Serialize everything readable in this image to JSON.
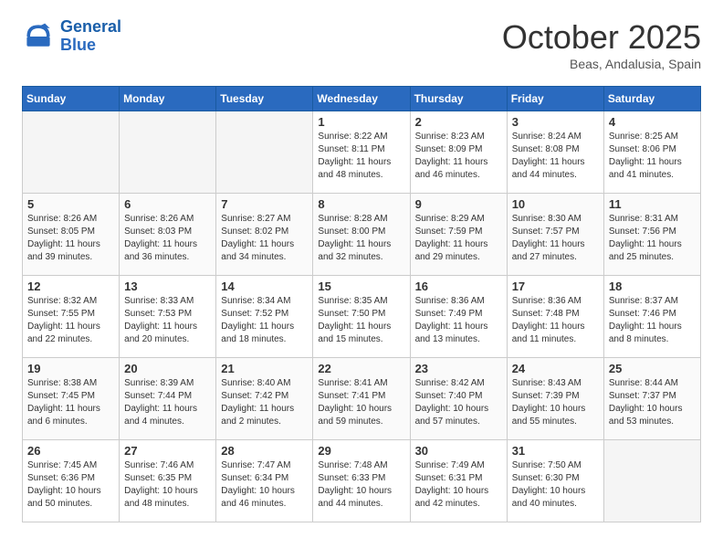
{
  "header": {
    "logo_line1": "General",
    "logo_line2": "Blue",
    "month": "October 2025",
    "location": "Beas, Andalusia, Spain"
  },
  "days_of_week": [
    "Sunday",
    "Monday",
    "Tuesday",
    "Wednesday",
    "Thursday",
    "Friday",
    "Saturday"
  ],
  "weeks": [
    [
      {
        "day": "",
        "empty": true
      },
      {
        "day": "",
        "empty": true
      },
      {
        "day": "",
        "empty": true
      },
      {
        "day": "1",
        "sunrise": "Sunrise: 8:22 AM",
        "sunset": "Sunset: 8:11 PM",
        "daylight": "Daylight: 11 hours and 48 minutes."
      },
      {
        "day": "2",
        "sunrise": "Sunrise: 8:23 AM",
        "sunset": "Sunset: 8:09 PM",
        "daylight": "Daylight: 11 hours and 46 minutes."
      },
      {
        "day": "3",
        "sunrise": "Sunrise: 8:24 AM",
        "sunset": "Sunset: 8:08 PM",
        "daylight": "Daylight: 11 hours and 44 minutes."
      },
      {
        "day": "4",
        "sunrise": "Sunrise: 8:25 AM",
        "sunset": "Sunset: 8:06 PM",
        "daylight": "Daylight: 11 hours and 41 minutes."
      }
    ],
    [
      {
        "day": "5",
        "sunrise": "Sunrise: 8:26 AM",
        "sunset": "Sunset: 8:05 PM",
        "daylight": "Daylight: 11 hours and 39 minutes."
      },
      {
        "day": "6",
        "sunrise": "Sunrise: 8:26 AM",
        "sunset": "Sunset: 8:03 PM",
        "daylight": "Daylight: 11 hours and 36 minutes."
      },
      {
        "day": "7",
        "sunrise": "Sunrise: 8:27 AM",
        "sunset": "Sunset: 8:02 PM",
        "daylight": "Daylight: 11 hours and 34 minutes."
      },
      {
        "day": "8",
        "sunrise": "Sunrise: 8:28 AM",
        "sunset": "Sunset: 8:00 PM",
        "daylight": "Daylight: 11 hours and 32 minutes."
      },
      {
        "day": "9",
        "sunrise": "Sunrise: 8:29 AM",
        "sunset": "Sunset: 7:59 PM",
        "daylight": "Daylight: 11 hours and 29 minutes."
      },
      {
        "day": "10",
        "sunrise": "Sunrise: 8:30 AM",
        "sunset": "Sunset: 7:57 PM",
        "daylight": "Daylight: 11 hours and 27 minutes."
      },
      {
        "day": "11",
        "sunrise": "Sunrise: 8:31 AM",
        "sunset": "Sunset: 7:56 PM",
        "daylight": "Daylight: 11 hours and 25 minutes."
      }
    ],
    [
      {
        "day": "12",
        "sunrise": "Sunrise: 8:32 AM",
        "sunset": "Sunset: 7:55 PM",
        "daylight": "Daylight: 11 hours and 22 minutes."
      },
      {
        "day": "13",
        "sunrise": "Sunrise: 8:33 AM",
        "sunset": "Sunset: 7:53 PM",
        "daylight": "Daylight: 11 hours and 20 minutes."
      },
      {
        "day": "14",
        "sunrise": "Sunrise: 8:34 AM",
        "sunset": "Sunset: 7:52 PM",
        "daylight": "Daylight: 11 hours and 18 minutes."
      },
      {
        "day": "15",
        "sunrise": "Sunrise: 8:35 AM",
        "sunset": "Sunset: 7:50 PM",
        "daylight": "Daylight: 11 hours and 15 minutes."
      },
      {
        "day": "16",
        "sunrise": "Sunrise: 8:36 AM",
        "sunset": "Sunset: 7:49 PM",
        "daylight": "Daylight: 11 hours and 13 minutes."
      },
      {
        "day": "17",
        "sunrise": "Sunrise: 8:36 AM",
        "sunset": "Sunset: 7:48 PM",
        "daylight": "Daylight: 11 hours and 11 minutes."
      },
      {
        "day": "18",
        "sunrise": "Sunrise: 8:37 AM",
        "sunset": "Sunset: 7:46 PM",
        "daylight": "Daylight: 11 hours and 8 minutes."
      }
    ],
    [
      {
        "day": "19",
        "sunrise": "Sunrise: 8:38 AM",
        "sunset": "Sunset: 7:45 PM",
        "daylight": "Daylight: 11 hours and 6 minutes."
      },
      {
        "day": "20",
        "sunrise": "Sunrise: 8:39 AM",
        "sunset": "Sunset: 7:44 PM",
        "daylight": "Daylight: 11 hours and 4 minutes."
      },
      {
        "day": "21",
        "sunrise": "Sunrise: 8:40 AM",
        "sunset": "Sunset: 7:42 PM",
        "daylight": "Daylight: 11 hours and 2 minutes."
      },
      {
        "day": "22",
        "sunrise": "Sunrise: 8:41 AM",
        "sunset": "Sunset: 7:41 PM",
        "daylight": "Daylight: 10 hours and 59 minutes."
      },
      {
        "day": "23",
        "sunrise": "Sunrise: 8:42 AM",
        "sunset": "Sunset: 7:40 PM",
        "daylight": "Daylight: 10 hours and 57 minutes."
      },
      {
        "day": "24",
        "sunrise": "Sunrise: 8:43 AM",
        "sunset": "Sunset: 7:39 PM",
        "daylight": "Daylight: 10 hours and 55 minutes."
      },
      {
        "day": "25",
        "sunrise": "Sunrise: 8:44 AM",
        "sunset": "Sunset: 7:37 PM",
        "daylight": "Daylight: 10 hours and 53 minutes."
      }
    ],
    [
      {
        "day": "26",
        "sunrise": "Sunrise: 7:45 AM",
        "sunset": "Sunset: 6:36 PM",
        "daylight": "Daylight: 10 hours and 50 minutes."
      },
      {
        "day": "27",
        "sunrise": "Sunrise: 7:46 AM",
        "sunset": "Sunset: 6:35 PM",
        "daylight": "Daylight: 10 hours and 48 minutes."
      },
      {
        "day": "28",
        "sunrise": "Sunrise: 7:47 AM",
        "sunset": "Sunset: 6:34 PM",
        "daylight": "Daylight: 10 hours and 46 minutes."
      },
      {
        "day": "29",
        "sunrise": "Sunrise: 7:48 AM",
        "sunset": "Sunset: 6:33 PM",
        "daylight": "Daylight: 10 hours and 44 minutes."
      },
      {
        "day": "30",
        "sunrise": "Sunrise: 7:49 AM",
        "sunset": "Sunset: 6:31 PM",
        "daylight": "Daylight: 10 hours and 42 minutes."
      },
      {
        "day": "31",
        "sunrise": "Sunrise: 7:50 AM",
        "sunset": "Sunset: 6:30 PM",
        "daylight": "Daylight: 10 hours and 40 minutes."
      },
      {
        "day": "",
        "empty": true
      }
    ]
  ]
}
